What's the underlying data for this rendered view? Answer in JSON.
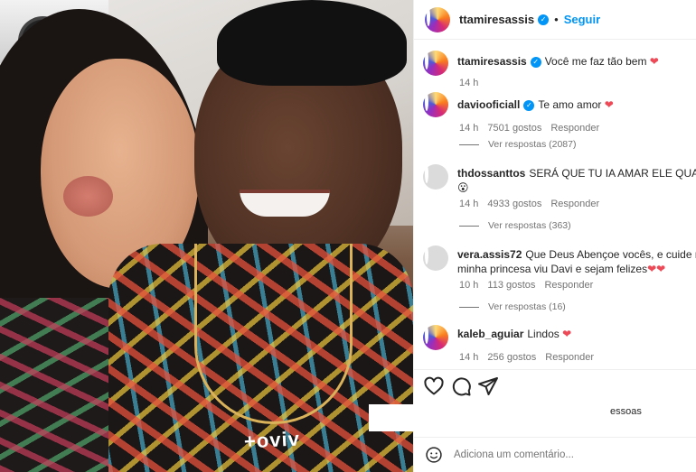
{
  "header": {
    "username": "ttamiresassis",
    "separator": "•",
    "follow_label": "Seguir"
  },
  "caption": {
    "username": "ttamiresassis",
    "text": "Você me faz tão bem",
    "time": "14 h"
  },
  "comments": [
    {
      "username": "daviooficiall",
      "verified": true,
      "text": "Te amo amor",
      "heart": true,
      "time": "14 h",
      "likes": "7501 gostos",
      "reply_label": "Responder",
      "view_replies": "Ver respostas (2087)"
    },
    {
      "username": "thdossanttos",
      "verified": false,
      "text": "SERÁ QUE TU IA AMAR ELE QUANDO ERA",
      "line2": "😮",
      "time": "14 h",
      "likes": "4933 gostos",
      "reply_label": "Responder",
      "view_replies": "Ver respostas (363)"
    },
    {
      "username": "vera.assis72",
      "verified": false,
      "text": "Que Deus Abençoe vocês, e cuide muito be",
      "line2": "minha princesa viu Davi e sejam felizes",
      "time": "10 h",
      "likes": "113 gostos",
      "reply_label": "Responder",
      "view_replies": "Ver respostas (16)"
    },
    {
      "username": "kaleb_aguiar",
      "verified": false,
      "text": "Lindos",
      "heart": true,
      "time": "14 h",
      "likes": "256 gostos",
      "reply_label": "Responder"
    }
  ],
  "actions": {
    "like_icon": "heart-outline-icon",
    "comment_icon": "speech-bubble-icon",
    "share_icon": "paper-plane-icon",
    "likes_tail": "essoas"
  },
  "comment_box": {
    "placeholder": "Adiciona um comentário...",
    "emoji_icon": "smiley-icon"
  },
  "photo": {
    "shirt_text": "+oviv"
  },
  "colors": {
    "accent": "#0095f6",
    "heart": "#ed4956",
    "muted": "#737373"
  }
}
